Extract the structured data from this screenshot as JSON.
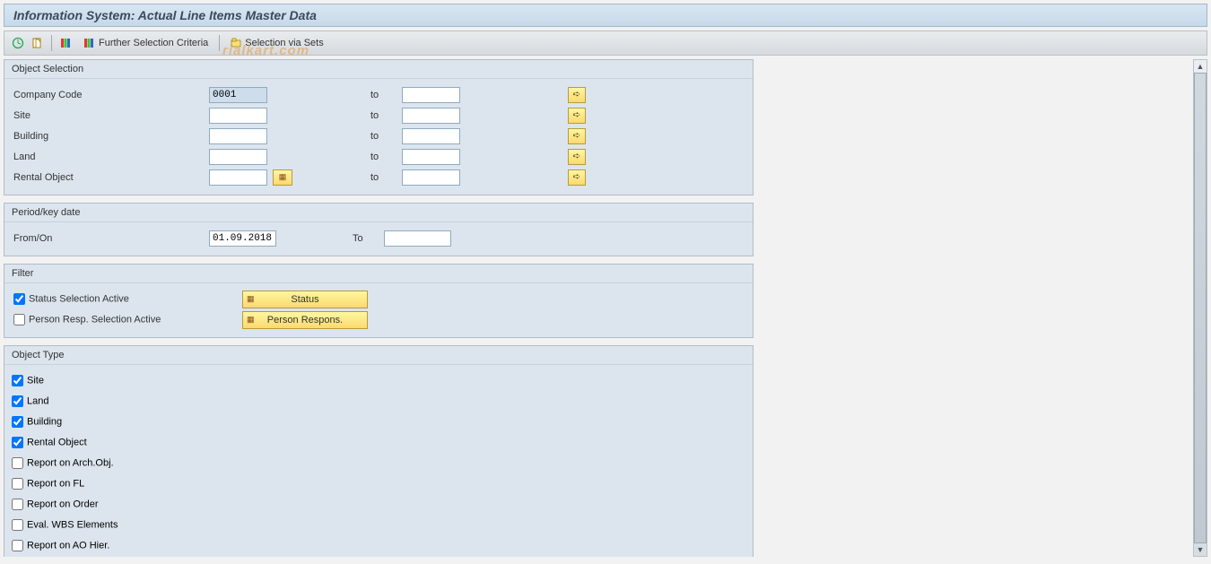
{
  "titlebar": {
    "text": "Information System: Actual Line Items Master Data"
  },
  "toolbar": {
    "further_sel": "Further Selection Criteria",
    "sel_via_sets": "Selection via Sets"
  },
  "watermark": "rialkart.com",
  "groups": {
    "object_selection": {
      "title": "Object Selection",
      "rows": [
        {
          "label": "Company Code",
          "from": "0001",
          "to": "",
          "selected": true,
          "helper": false
        },
        {
          "label": "Site",
          "from": "",
          "to": "",
          "selected": false,
          "helper": false
        },
        {
          "label": "Building",
          "from": "",
          "to": "",
          "selected": false,
          "helper": false
        },
        {
          "label": "Land",
          "from": "",
          "to": "",
          "selected": false,
          "helper": false
        },
        {
          "label": "Rental Object",
          "from": "",
          "to": "",
          "selected": false,
          "helper": true
        }
      ],
      "to_label": "to"
    },
    "period": {
      "title": "Period/key date",
      "from_label": "From/On",
      "from_value": "01.09.2018",
      "to_label": "To",
      "to_value": ""
    },
    "filter": {
      "title": "Filter",
      "status_chk_label": "Status Selection Active",
      "status_btn": "Status",
      "person_chk_label": "Person Resp. Selection Active",
      "person_btn": "Person Respons."
    },
    "object_type": {
      "title": "Object Type",
      "items": [
        {
          "label": "Site",
          "checked": true
        },
        {
          "label": "Land",
          "checked": true
        },
        {
          "label": "Building",
          "checked": true
        },
        {
          "label": "Rental Object",
          "checked": true
        },
        {
          "label": "Report on Arch.Obj.",
          "checked": false
        },
        {
          "label": "Report on FL",
          "checked": false
        },
        {
          "label": "Report on Order",
          "checked": false
        },
        {
          "label": "Eval. WBS Elements",
          "checked": false
        },
        {
          "label": "Report on AO Hier.",
          "checked": false
        }
      ]
    }
  }
}
